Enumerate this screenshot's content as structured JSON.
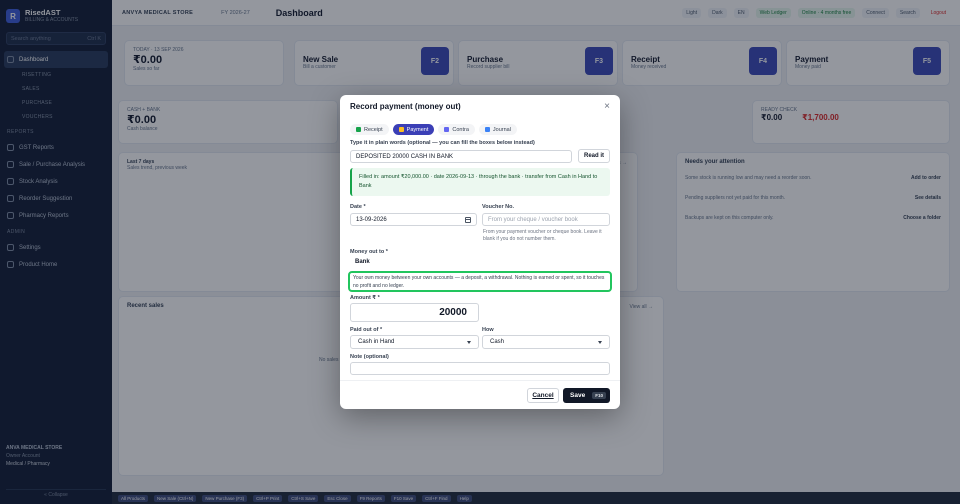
{
  "sidebar": {
    "brand_letter": "R",
    "brand_name": "RisedAST",
    "brand_sub": "BILLING & ACCOUNTS",
    "search_placeholder": "Search anything",
    "search_shortcut": "Ctrl K",
    "items": [
      {
        "label": "Dashboard",
        "kind": "active"
      },
      {
        "label": "RISETTING",
        "kind": "sub"
      },
      {
        "label": "SALES",
        "kind": "sub"
      },
      {
        "label": "PURCHASE",
        "kind": "sub"
      },
      {
        "label": "VOUCHERS",
        "kind": "sub"
      },
      {
        "label": "REPORTS",
        "kind": "section"
      },
      {
        "label": "GST Reports",
        "kind": "item"
      },
      {
        "label": "Sale / Purchase Analysis",
        "kind": "item"
      },
      {
        "label": "Stock Analysis",
        "kind": "item"
      },
      {
        "label": "Reorder Suggestion",
        "kind": "item"
      },
      {
        "label": "Pharmacy Reports",
        "kind": "item"
      },
      {
        "label": "ADMIN",
        "kind": "section"
      },
      {
        "label": "Settings",
        "kind": "item"
      },
      {
        "label": "Product Home",
        "kind": "item"
      }
    ],
    "footer_store": "ANVA MEDICAL STORE",
    "footer_owner": "Owner Account",
    "footer_status": "Medical / Pharmacy",
    "collapse": "« Collapse"
  },
  "topbar": {
    "store": "ANVYA MEDICAL STORE",
    "fy": "FY 2026-27",
    "title": "Dashboard",
    "chips": [
      "Light",
      "Dark",
      "EN",
      "Web Ledger",
      "Online · 4 months free",
      "Connect",
      "Search"
    ],
    "logout": "Logout"
  },
  "background": {
    "today_label": "TODAY · 13 SEP 2026",
    "today_value": "₹0.00",
    "today_sub": "Sales so far",
    "cards": [
      {
        "title": "New Sale",
        "sub": "Bill a customer",
        "key": "F2"
      },
      {
        "title": "Purchase",
        "sub": "Record supplier bill",
        "key": "F3"
      },
      {
        "title": "Receipt",
        "sub": "Money received",
        "key": "F4"
      },
      {
        "title": "Payment",
        "sub": "Money paid",
        "key": "F5"
      }
    ],
    "cash_label": "CASH + BANK",
    "cash_value": "₹0.00",
    "cash_sub": "Cash balance",
    "ready_label": "READY CHECK",
    "ready_value": "₹0.00",
    "ready_value2": "₹1,700.00",
    "last7": "Last 7 days",
    "last7_sub": "Sales trend, previous week",
    "open_reports": "Full reports →",
    "attention": "Needs your attention",
    "attention_items": [
      {
        "text": "Some stock is running low and may need a reorder soon.",
        "action": "Add to order"
      },
      {
        "text": "Pending suppliers not yet paid for this month.",
        "action": "See details"
      },
      {
        "text": "Backups are kept on this computer only.",
        "action": "Choose a folder"
      }
    ],
    "recent": "Recent sales",
    "view_all": "View all →",
    "no_sales": "No sales yet today",
    "bottom_items": [
      "All Products",
      "New Sale (Ctrl+N)",
      "New Purchase (F3)",
      "Ctrl+P Print",
      "Ctrl+S Save",
      "Esc Close",
      "F9 Reports",
      "F10 Save",
      "Ctrl+F Find",
      "Help"
    ]
  },
  "modal": {
    "title": "Record payment (money out)",
    "close_glyph": "×",
    "tabs": [
      {
        "label": "Receipt",
        "active": false,
        "color": "#16a34a"
      },
      {
        "label": "Payment",
        "active": true,
        "color": "#fbbf24"
      },
      {
        "label": "Contra",
        "active": false,
        "color": "#6366f1"
      },
      {
        "label": "Journal",
        "active": false,
        "color": "#3b82f6"
      }
    ],
    "plain_label": "Type it in plain words (optional — you can fill the boxes below instead)",
    "plain_value": "DEPOSITED 20000 CASH IN BANK",
    "read_it": "Read it",
    "callout": "Filled in: amount ₹20,000.00 · date 2026-09-13 · through the bank · transfer from Cash in Hand to Bank",
    "date_label": "Date *",
    "date_value": "13-09-2026",
    "voucher_label": "Voucher No.",
    "voucher_placeholder": "From your cheque / voucher book",
    "voucher_help": "From your payment voucher or cheque book. Leave it blank if you do not number them.",
    "money_out_label": "Money out to *",
    "money_out_value": "Bank",
    "money_out_note": "Your own money between your own accounts — a deposit, a withdrawal. Nothing is earned or spent, so it touches no profit and no ledger.",
    "amount_label": "Amount ₹ *",
    "amount_value": "20000",
    "paid_out_label": "Paid out of *",
    "paid_out_value": "Cash in Hand",
    "how_label": "How",
    "how_value": "Cash",
    "note_label": "Note (optional)",
    "note_value": "",
    "cancel": "Cancel",
    "save": "Save",
    "save_key": "F10"
  }
}
